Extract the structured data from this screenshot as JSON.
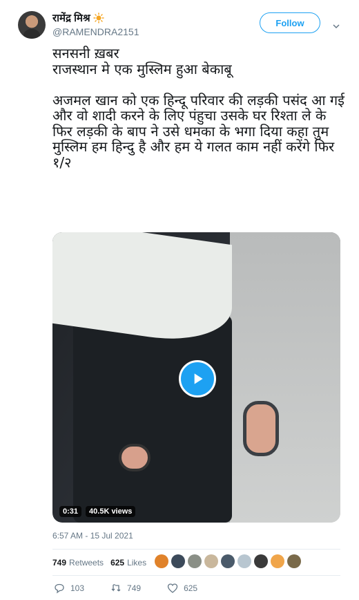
{
  "user": {
    "display_name": "रामेंद्र मिश्र",
    "emoji_icon": "sun-icon",
    "handle": "@RAMENDRA2151"
  },
  "follow_button": {
    "label": "Follow"
  },
  "tweet": {
    "text": "सनसनी ख़बर\nराजस्थान मे एक मुस्लिम हुआ बेकाबू\n\nअजमल खान को एक हिन्दू परिवार की लड़की पसंद आ गई और वो शादी करने के लिए पंहुचा उसके घर रिश्ता ले के\n फिर लड़की के बाप ने उसे धमका के भगा दिया कहा तुम मुस्लिम हम हिन्दु है और हम ये गलत काम नहीं करेंगे फिर\n१/२"
  },
  "media": {
    "duration": "0:31",
    "views": "40.5K views"
  },
  "timestamp": "6:57 AM - 15 Jul 2021",
  "stats": {
    "retweets_count": "749",
    "retweets_label": "Retweets",
    "likes_count": "625",
    "likes_label": "Likes"
  },
  "likers": [
    "#e0822a",
    "#3c4a5a",
    "#8a8f86",
    "#c9b79c",
    "#4a5a6a",
    "#b8c6d0",
    "#3a3a3a",
    "#f0a54a",
    "#7a6a4a"
  ],
  "actions": {
    "replies": "103",
    "retweets": "749",
    "likes": "625"
  },
  "colors": {
    "accent": "#1da1f2",
    "secondary_text": "#657786",
    "divider": "#e6ecf0"
  }
}
